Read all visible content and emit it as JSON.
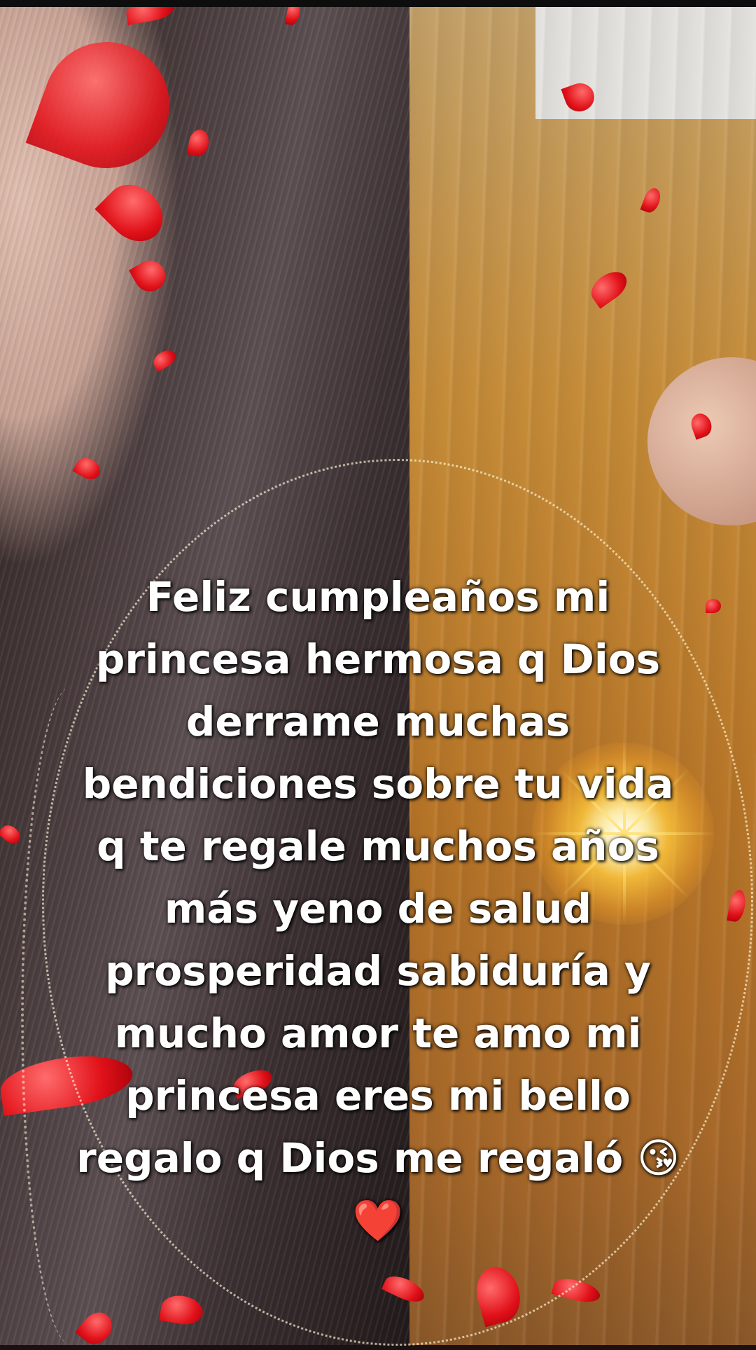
{
  "caption": {
    "text": "Feliz cumpleaños mi\nprincesa hermosa q Dios\nderrame muchas\nbendiciones sobre tu vida\nq te regale muchos años\nmás yeno de salud\nprosperidad sabiduría y\nmucho amor te amo mi\nprincesa eres mi bello\nregalo q Dios me regaló 😘\n❤️"
  },
  "colors": {
    "caption_text": "#ffffff",
    "petals": "#e1121a",
    "sparkles": "#fffadc"
  }
}
